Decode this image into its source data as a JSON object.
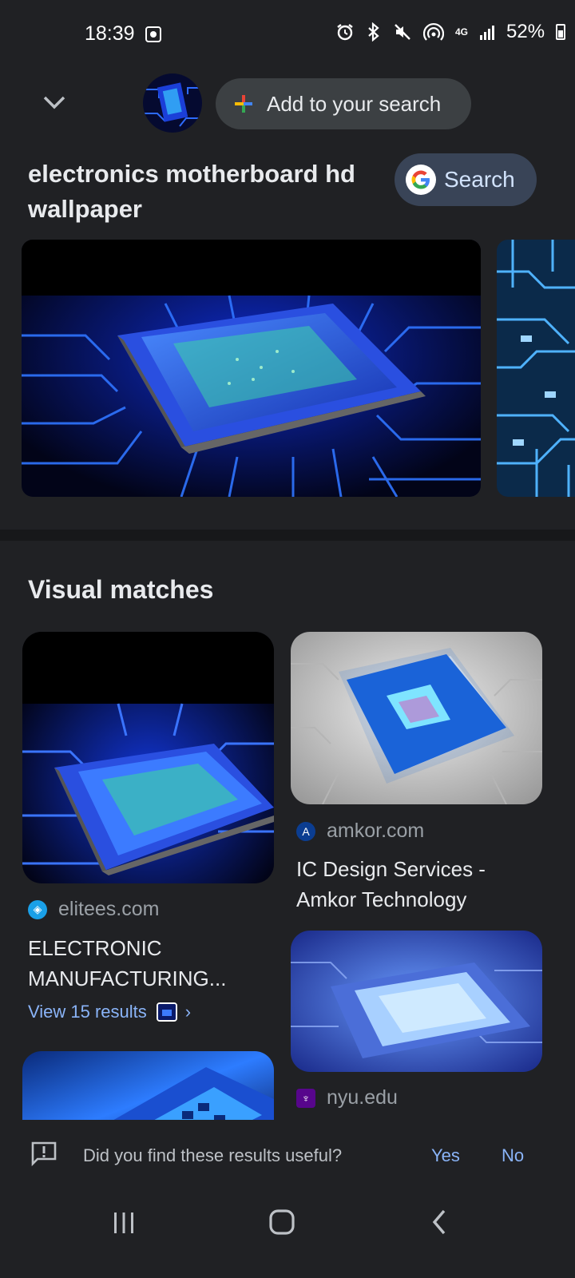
{
  "status_bar": {
    "time": "18:39",
    "signal_label": "4G",
    "battery": "52%",
    "icons": [
      "screenshot-icon",
      "alarm-icon",
      "bluetooth-icon",
      "mute-icon",
      "hotspot-icon",
      "network-4g-icon",
      "signal-icon",
      "battery-icon"
    ]
  },
  "header": {
    "add_to_search": "Add to your search",
    "query": "electronics motherboard hd wallpaper",
    "search_button": "Search"
  },
  "visual_matches": {
    "title": "Visual matches",
    "results": [
      {
        "site": "elitees.com",
        "title": "ELECTRONIC MANUFACTURING...",
        "view_more": "View 15 results"
      },
      {
        "site": "amkor.com",
        "title": "IC Design Services - Amkor Technology"
      },
      {
        "site": "nyu.edu"
      }
    ]
  },
  "feedback": {
    "question": "Did you find these results useful?",
    "yes": "Yes",
    "no": "No"
  },
  "colors": {
    "background": "#202124",
    "accent": "#8ab4f8",
    "chip": "#3c4043"
  }
}
